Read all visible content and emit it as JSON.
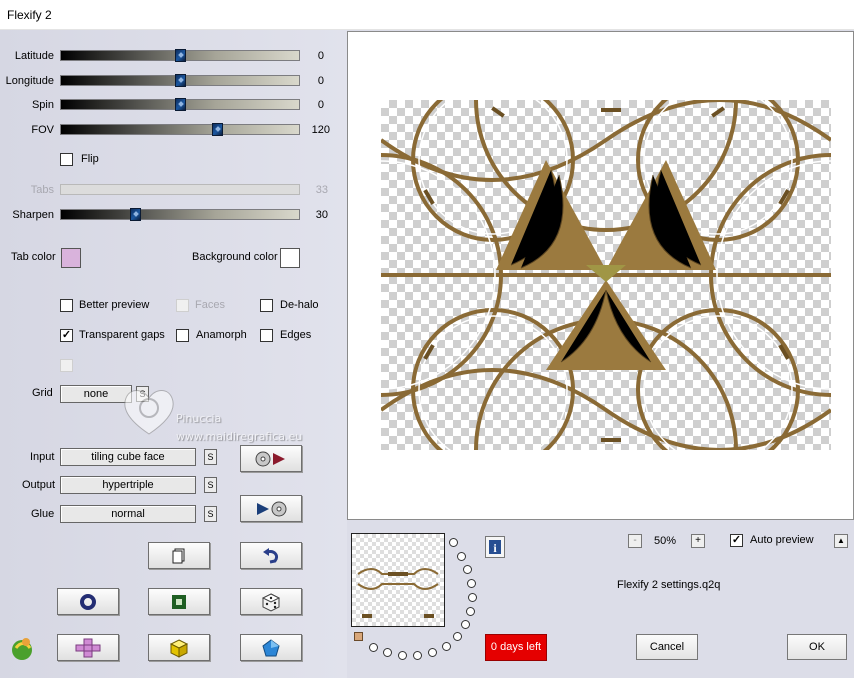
{
  "window": {
    "title": "Flexify 2"
  },
  "sliders": [
    {
      "label": "Latitude",
      "value": "0",
      "fraction": 0.5
    },
    {
      "label": "Longitude",
      "value": "0",
      "fraction": 0.5
    },
    {
      "label": "Spin",
      "value": "0",
      "fraction": 0.5
    },
    {
      "label": "FOV",
      "value": "120",
      "fraction": 0.65
    },
    {
      "label": "Tabs",
      "value": "33",
      "disabled": true
    },
    {
      "label": "Sharpen",
      "value": "30",
      "fraction": 0.3
    }
  ],
  "flip": {
    "label": "Flip",
    "checked": false
  },
  "colors": {
    "tab_color_label": "Tab color",
    "tab_color": "#d9b3dc",
    "background_color_label": "Background color",
    "background_color": "#ffffff"
  },
  "options": {
    "better_preview": {
      "label": "Better preview",
      "checked": false
    },
    "faces": {
      "label": "Faces",
      "checked": false,
      "disabled": true
    },
    "de_halo": {
      "label": "De-halo",
      "checked": false
    },
    "transparent_gaps": {
      "label": "Transparent gaps",
      "checked": true
    },
    "anamorph": {
      "label": "Anamorph",
      "checked": false
    },
    "edges": {
      "label": "Edges",
      "checked": false
    }
  },
  "grid": {
    "label": "Grid",
    "value": "none",
    "s": "S"
  },
  "watermark": {
    "name": "Pinuccia",
    "site": "www.maidiregrafica.eu"
  },
  "io": {
    "input_label": "Input",
    "input_value": "tiling cube face",
    "output_label": "Output",
    "output_value": "hypertriple",
    "glue_label": "Glue",
    "glue_value": "normal",
    "s": "S"
  },
  "preview": {
    "zoom": "50%",
    "zoom_minus": "-",
    "zoom_plus": "+",
    "auto_preview_label": "Auto preview",
    "auto_preview_checked": true,
    "settings_file": "Flexify 2 settings.q2q",
    "info": "i",
    "collapse": "▲"
  },
  "footer": {
    "days_left": "0 days left",
    "cancel": "Cancel",
    "ok": "OK"
  },
  "accent_colors": {
    "tan": "#8a6a35",
    "olive": "#9b8c3d",
    "thumb_blue": "#1b57a0",
    "red": "#e50000"
  }
}
